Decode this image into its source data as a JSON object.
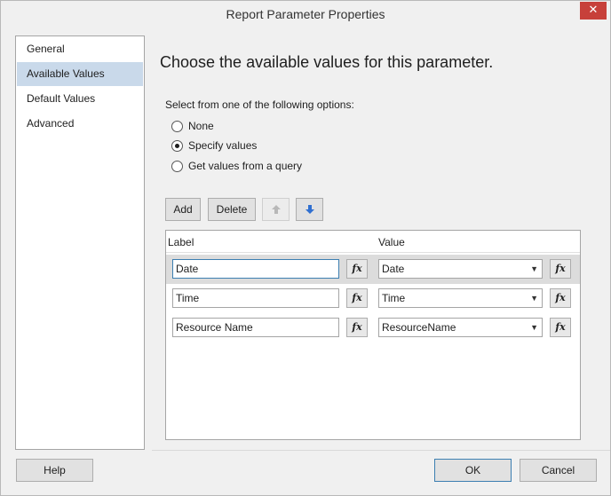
{
  "window": {
    "title": "Report Parameter Properties",
    "close_glyph": "✕",
    "accent_close": "#c7403a"
  },
  "sidebar": {
    "items": [
      {
        "label": "General",
        "selected": false
      },
      {
        "label": "Available Values",
        "selected": true
      },
      {
        "label": "Default Values",
        "selected": false
      },
      {
        "label": "Advanced",
        "selected": false
      }
    ]
  },
  "main": {
    "heading": "Choose the available values for this parameter.",
    "options_label": "Select from one of the following options:",
    "radio_options": [
      {
        "label": "None",
        "checked": false
      },
      {
        "label": "Specify values",
        "checked": true
      },
      {
        "label": "Get values from a query",
        "checked": false
      }
    ],
    "toolbar": {
      "add_label": "Add",
      "delete_label": "Delete",
      "move_up_icon": "up-arrow-icon",
      "move_down_icon": "down-arrow-icon"
    },
    "grid": {
      "columns": [
        "Label",
        "Value"
      ],
      "fx_label": "fx",
      "rows": [
        {
          "label": "Date",
          "value": "Date",
          "selected": true
        },
        {
          "label": "Time",
          "value": "Time",
          "selected": false
        },
        {
          "label": "Resource Name",
          "value": "ResourceName",
          "selected": false
        }
      ]
    }
  },
  "footer": {
    "help_label": "Help",
    "ok_label": "OK",
    "cancel_label": "Cancel"
  }
}
